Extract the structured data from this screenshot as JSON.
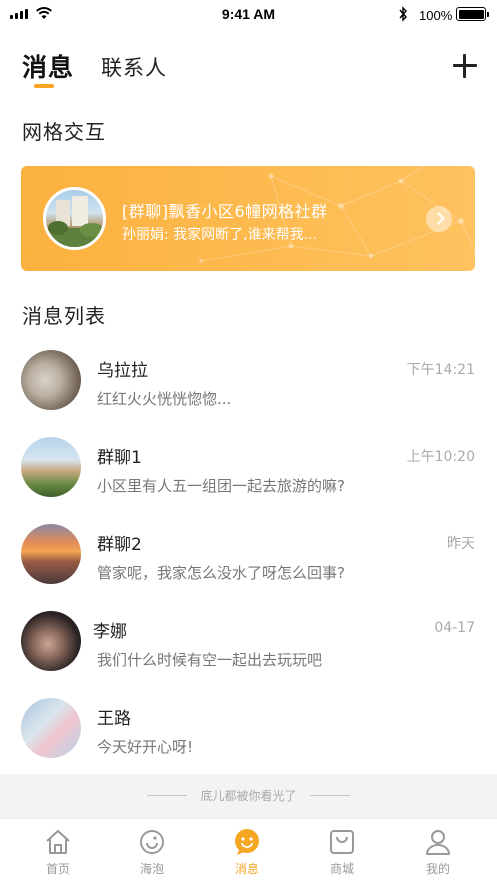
{
  "status_bar": {
    "time": "9:41 AM",
    "battery": "100%"
  },
  "header": {
    "tab_messages": "消息",
    "tab_contacts": "联系人",
    "add_icon": "plus-icon"
  },
  "grid_section": {
    "title": "网格交互",
    "card": {
      "title": "[群聊]飘香小区6幢网格社群",
      "preview": "孙丽娟: 我家网断了,谁来帮我...",
      "accent": "#FBB13E"
    }
  },
  "message_section": {
    "title": "消息列表",
    "items": [
      {
        "name": "乌拉拉",
        "preview": "红红火火恍恍惚惚...",
        "time": "下午14:21"
      },
      {
        "name": "群聊1",
        "preview": "小区里有人五一组团一起去旅游的嘛?",
        "time": "上午10:20"
      },
      {
        "name": "群聊2",
        "preview": "管家呢，我家怎么没水了呀怎么回事?",
        "time": "昨天"
      },
      {
        "name": "李娜",
        "preview": "我们什么时候有空一起出去玩玩吧",
        "time": "04-17"
      },
      {
        "name": "王路",
        "preview": "今天好开心呀!",
        "time": ""
      }
    ]
  },
  "end_text": "底儿都被你看光了",
  "tabbar": {
    "items": [
      {
        "label": "首页",
        "icon": "home-icon"
      },
      {
        "label": "海泡",
        "icon": "bubble-icon"
      },
      {
        "label": "消息",
        "icon": "message-icon"
      },
      {
        "label": "商城",
        "icon": "shop-icon"
      },
      {
        "label": "我的",
        "icon": "profile-icon"
      }
    ],
    "active_color": "#F5A623",
    "inactive_color": "#999999"
  }
}
